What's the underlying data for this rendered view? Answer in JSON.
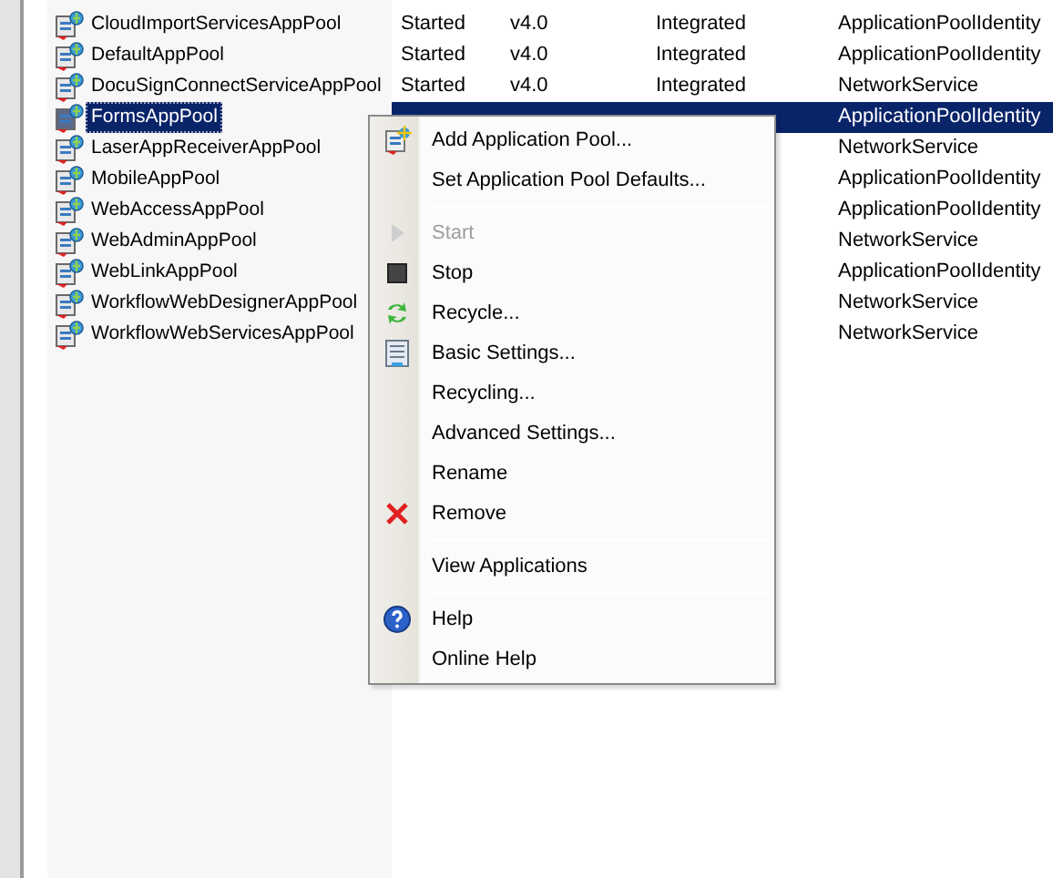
{
  "app_pools": {
    "rows": [
      {
        "name": "CloudImportServicesAppPool",
        "status": "Started",
        "dotnet_version": "v4.0",
        "pipeline": "Integrated",
        "identity": "ApplicationPoolIdentity",
        "selected": false
      },
      {
        "name": "DefaultAppPool",
        "status": "Started",
        "dotnet_version": "v4.0",
        "pipeline": "Integrated",
        "identity": "ApplicationPoolIdentity",
        "selected": false
      },
      {
        "name": "DocuSignConnectServiceAppPool",
        "status": "Started",
        "dotnet_version": "v4.0",
        "pipeline": "Integrated",
        "identity": "NetworkService",
        "selected": false
      },
      {
        "name": "FormsAppPool",
        "identity": "ApplicationPoolIdentity",
        "selected": true
      },
      {
        "name": "LaserAppReceiverAppPool",
        "identity": "NetworkService",
        "selected": false
      },
      {
        "name": "MobileAppPool",
        "identity": "ApplicationPoolIdentity",
        "selected": false
      },
      {
        "name": "WebAccessAppPool",
        "identity": "ApplicationPoolIdentity",
        "selected": false
      },
      {
        "name": "WebAdminAppPool",
        "identity": "NetworkService",
        "selected": false
      },
      {
        "name": "WebLinkAppPool",
        "identity": "ApplicationPoolIdentity",
        "selected": false
      },
      {
        "name": "WorkflowWebDesignerAppPool",
        "identity": "NetworkService",
        "selected": false
      },
      {
        "name": "WorkflowWebServicesAppPool",
        "identity": "NetworkService",
        "selected": false
      }
    ]
  },
  "context_menu": {
    "items": [
      {
        "kind": "item",
        "label": "Add Application Pool...",
        "disabled": false
      },
      {
        "kind": "item",
        "label": "Set Application Pool Defaults...",
        "disabled": false
      },
      {
        "kind": "separator"
      },
      {
        "kind": "item",
        "label": "Start",
        "disabled": true
      },
      {
        "kind": "item",
        "label": "Stop",
        "disabled": false
      },
      {
        "kind": "item",
        "label": "Recycle...",
        "disabled": false
      },
      {
        "kind": "item",
        "label": "Basic Settings...",
        "disabled": false
      },
      {
        "kind": "item",
        "label": "Recycling...",
        "disabled": false
      },
      {
        "kind": "item",
        "label": "Advanced Settings...",
        "disabled": false
      },
      {
        "kind": "item",
        "label": "Rename",
        "disabled": false
      },
      {
        "kind": "item",
        "label": "Remove",
        "disabled": false
      },
      {
        "kind": "separator"
      },
      {
        "kind": "item",
        "label": "View Applications",
        "disabled": false
      },
      {
        "kind": "separator"
      },
      {
        "kind": "item",
        "label": "Help",
        "disabled": false
      },
      {
        "kind": "item",
        "label": "Online Help",
        "disabled": false
      }
    ]
  }
}
